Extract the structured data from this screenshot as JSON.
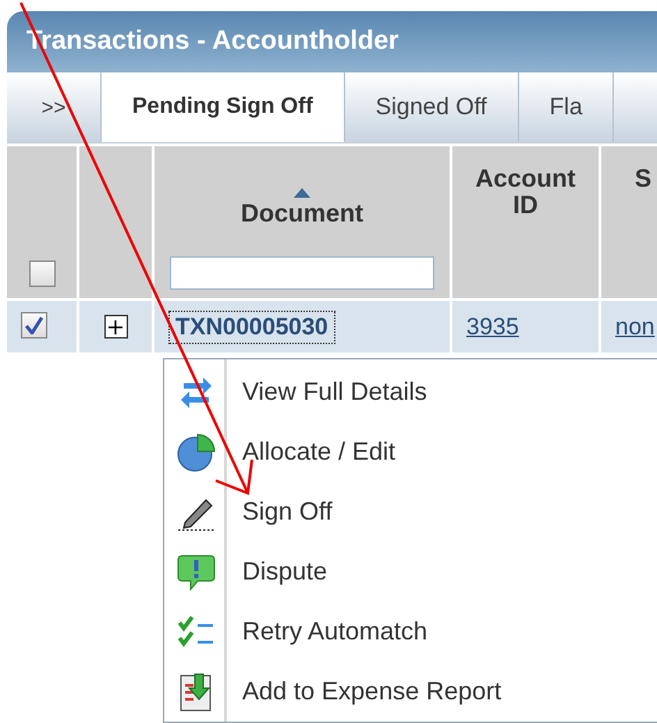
{
  "window": {
    "title": "Transactions - Accountholder"
  },
  "tabs_toggle": ">>",
  "tabs": [
    {
      "label": "Pending Sign Off",
      "selected": true
    },
    {
      "label": "Signed Off",
      "selected": false
    },
    {
      "label": "Fla",
      "selected": false
    }
  ],
  "table": {
    "select_all": {
      "checked": false
    },
    "columns": [
      {
        "label": "Document",
        "sorted": true
      },
      {
        "label": "Account ID",
        "sorted": false
      },
      {
        "label": "S",
        "sorted": false
      }
    ],
    "rows": [
      {
        "checked": true,
        "expand": "+",
        "document": "TXN00005030",
        "account_id": "3935",
        "column_3": "non"
      }
    ]
  },
  "context_menu": [
    {
      "kind": "details",
      "label": "View Full Details"
    },
    {
      "kind": "allocate",
      "label": "Allocate / Edit"
    },
    {
      "kind": "signoff",
      "label": "Sign Off"
    },
    {
      "kind": "dispute",
      "label": "Dispute"
    },
    {
      "kind": "retry",
      "label": "Retry Automatch"
    },
    {
      "kind": "expense",
      "label": "Add to Expense Report"
    }
  ]
}
